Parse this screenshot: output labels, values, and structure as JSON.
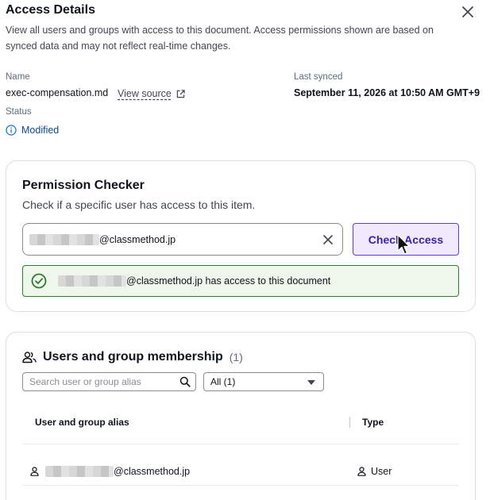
{
  "panel": {
    "title": "Access Details",
    "description": "View all users and groups with access to this document. Access permissions shown are based on synced data and may not reflect real-time changes."
  },
  "details": {
    "name_label": "Name",
    "name_value": "exec-compensation.md",
    "view_source": "View source",
    "last_synced_label": "Last synced",
    "last_synced_value": "September 11, 2026 at 10:50 AM GMT+9",
    "status_label": "Status",
    "status_value": "Modified"
  },
  "permission_checker": {
    "title": "Permission Checker",
    "subtitle": "Check if a specific user has access to this item.",
    "email_domain": "@classmethod.jp",
    "button_label": "Check Access",
    "result_domain": "@classmethod.jp",
    "result_text": " has access to this document"
  },
  "membership": {
    "title": "Users and group membership",
    "count": "(1)",
    "search_placeholder": "Search user or group alias",
    "filter_value": "All (1)",
    "columns": [
      "User and group alias",
      "Type"
    ],
    "rows": [
      {
        "alias_domain": "@classmethod.jp",
        "type": "User"
      }
    ]
  },
  "icons": [
    "close-icon",
    "external-link-icon",
    "info-icon",
    "clear-icon",
    "cursor-icon",
    "check-circle-icon",
    "users-icon",
    "search-icon",
    "caret-down-icon",
    "user-icon"
  ],
  "colors": {
    "accent": "#5c3bd6",
    "success_border": "#2e7a2e",
    "success_bg": "#eff7ec",
    "info": "#0972d3"
  }
}
